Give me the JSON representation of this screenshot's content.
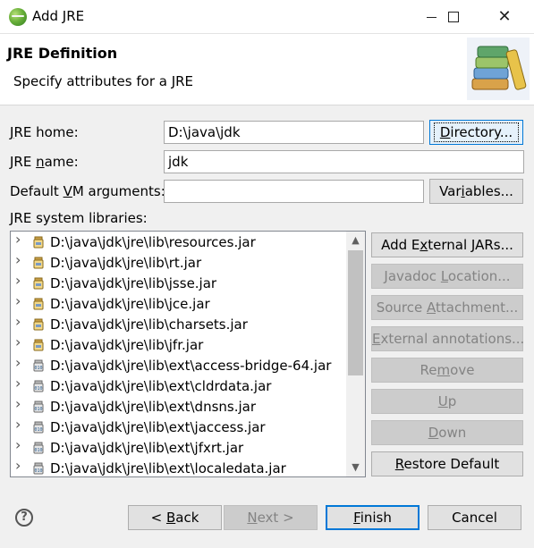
{
  "window": {
    "title": "Add JRE",
    "close_glyph": "✕"
  },
  "banner": {
    "title": "JRE Definition",
    "description": "Specify attributes for a JRE"
  },
  "form": {
    "jre_home_label_pre": "",
    "jre_home_label_mnemonic": "J",
    "jre_home_label_post": "RE home:",
    "jre_home_value": "D:\\java\\jdk",
    "directory_button_pre": "",
    "directory_button_mnemonic": "D",
    "directory_button_post": "irectory...",
    "jre_name_label_pre": "JRE ",
    "jre_name_label_mnemonic": "n",
    "jre_name_label_post": "ame:",
    "jre_name_value": "jdk",
    "vm_args_label_pre": "Default ",
    "vm_args_label_mnemonic": "V",
    "vm_args_label_post": "M arguments:",
    "vm_args_value": "",
    "variables_button_pre": "Var",
    "variables_button_mnemonic": "i",
    "variables_button_post": "ables...",
    "libraries_label": "JRE system libraries:"
  },
  "libraries": [
    {
      "path": "D:\\java\\jdk\\jre\\lib\\resources.jar",
      "icon": "jar-icon"
    },
    {
      "path": "D:\\java\\jdk\\jre\\lib\\rt.jar",
      "icon": "jar-icon"
    },
    {
      "path": "D:\\java\\jdk\\jre\\lib\\jsse.jar",
      "icon": "jar-icon"
    },
    {
      "path": "D:\\java\\jdk\\jre\\lib\\jce.jar",
      "icon": "jar-icon"
    },
    {
      "path": "D:\\java\\jdk\\jre\\lib\\charsets.jar",
      "icon": "jar-icon"
    },
    {
      "path": "D:\\java\\jdk\\jre\\lib\\jfr.jar",
      "icon": "jar-icon"
    },
    {
      "path": "D:\\java\\jdk\\jre\\lib\\ext\\access-bridge-64.jar",
      "icon": "binary-jar-icon"
    },
    {
      "path": "D:\\java\\jdk\\jre\\lib\\ext\\cldrdata.jar",
      "icon": "binary-jar-icon"
    },
    {
      "path": "D:\\java\\jdk\\jre\\lib\\ext\\dnsns.jar",
      "icon": "binary-jar-icon"
    },
    {
      "path": "D:\\java\\jdk\\jre\\lib\\ext\\jaccess.jar",
      "icon": "binary-jar-icon"
    },
    {
      "path": "D:\\java\\jdk\\jre\\lib\\ext\\jfxrt.jar",
      "icon": "binary-jar-icon"
    },
    {
      "path": "D:\\java\\jdk\\jre\\lib\\ext\\localedata.jar",
      "icon": "binary-jar-icon"
    }
  ],
  "side_buttons": [
    {
      "pre": "Add E",
      "mnemonic": "x",
      "post": "ternal JARs...",
      "enabled": true
    },
    {
      "pre": "Javadoc ",
      "mnemonic": "L",
      "post": "ocation...",
      "enabled": false
    },
    {
      "pre": "Source ",
      "mnemonic": "A",
      "post": "ttachment...",
      "enabled": false
    },
    {
      "pre": "",
      "mnemonic": "E",
      "post": "xternal annotations...",
      "enabled": false
    },
    {
      "pre": "Re",
      "mnemonic": "m",
      "post": "ove",
      "enabled": false
    },
    {
      "pre": "",
      "mnemonic": "U",
      "post": "p",
      "enabled": false
    },
    {
      "pre": "",
      "mnemonic": "D",
      "post": "own",
      "enabled": false
    },
    {
      "pre": "",
      "mnemonic": "R",
      "post": "estore Default",
      "enabled": true
    }
  ],
  "footer": {
    "help_glyph": "?",
    "back_pre": "< ",
    "back_mnemonic": "B",
    "back_post": "ack",
    "next_pre": "",
    "next_mnemonic": "N",
    "next_post": "ext >",
    "finish_pre": "",
    "finish_mnemonic": "F",
    "finish_post": "inish",
    "cancel_label": "Cancel"
  },
  "colors": {
    "accent": "#0078d7",
    "disabled_text": "#838383"
  }
}
